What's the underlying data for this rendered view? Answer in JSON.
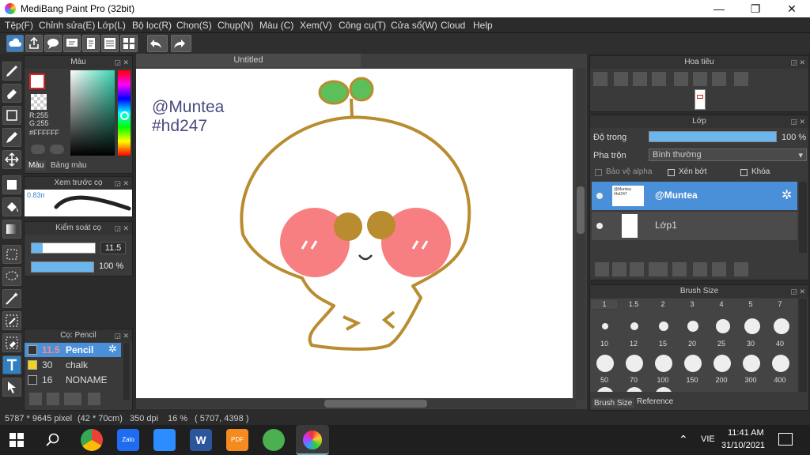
{
  "window": {
    "title": "MediBang Paint Pro (32bit)",
    "min": "—",
    "max": "❐",
    "close": "✕"
  },
  "menu": [
    "Tệp(F)",
    "Chỉnh sửa(E)",
    "Lớp(L)",
    "Bộ lọc(R)",
    "Chọn(S)",
    "Chụp(N)",
    "Màu (C)",
    "Xem(V)",
    "Công cụ(T)",
    "Cửa sổ(W)",
    "Cloud",
    "Help"
  ],
  "color_panel": {
    "title": "Màu",
    "r": "R:255",
    "g": "G:255",
    "hex": "#FFFFFF",
    "tab1": "Màu",
    "tab2": "Bảng màu"
  },
  "brush_preview": {
    "title": "Xem trước cọ",
    "size": "0.83n"
  },
  "brush_control": {
    "title": "Kiểm soát cọ",
    "size": "11.5",
    "opacity": "100 %",
    "opacity_frac": 1.0
  },
  "brush_list": {
    "title": "Cọ: Pencil",
    "items": [
      {
        "size": "11.5",
        "name": "Pencil",
        "color": "#333333"
      },
      {
        "size": "30",
        "name": "chalk",
        "color": "#f2d21b"
      },
      {
        "size": "16",
        "name": "NONAME",
        "color": "#333333"
      }
    ]
  },
  "document": {
    "tab": "Untitled",
    "text1": "@Muntea",
    "text2": "#hd247"
  },
  "navigator": {
    "title": "Hoa tiêu"
  },
  "layer_panel": {
    "title": "Lớp",
    "opacity_label": "Độ trong",
    "opacity_value": "100 %",
    "opacity_frac": 1.0,
    "blend_label": "Pha trộn",
    "blend_value": "Bình thường",
    "protect_alpha": "Bảo vệ alpha",
    "clipping": "Xén bớt",
    "lock": "Khóa",
    "layers": [
      {
        "name": "@Muntea",
        "thumb": "@Muntea #hd247"
      },
      {
        "name": "Lớp1"
      }
    ]
  },
  "brush_size": {
    "title": "Brush Size",
    "labels_row0": [
      "1",
      "1.5",
      "2",
      "3",
      "4",
      "5",
      "7"
    ],
    "labels_row1": [
      "10",
      "12",
      "15",
      "20",
      "25",
      "30",
      "40"
    ],
    "labels_row2": [
      "50",
      "70",
      "100",
      "150",
      "200",
      "300",
      "400"
    ],
    "tab1": "Brush Size",
    "tab2": "Reference"
  },
  "status": {
    "dimensions": "5787 * 9645 pixel",
    "cm": "(42 * 70cm)",
    "dpi": "350 dpi",
    "zoom": "16 %",
    "coords": "( 5707, 4398 )"
  },
  "taskbar": {
    "lang": "VIE",
    "time": "11:41 AM",
    "date": "31/10/2021",
    "zalo": "Zalo",
    "pdf": "PDF"
  },
  "colors": {
    "accent": "#4a90d9",
    "panel": "#3a3a3a",
    "cheek": "#f77f82",
    "outline": "#b88c2f",
    "leaf": "#5cbf5a",
    "text": "#4a4a80"
  }
}
